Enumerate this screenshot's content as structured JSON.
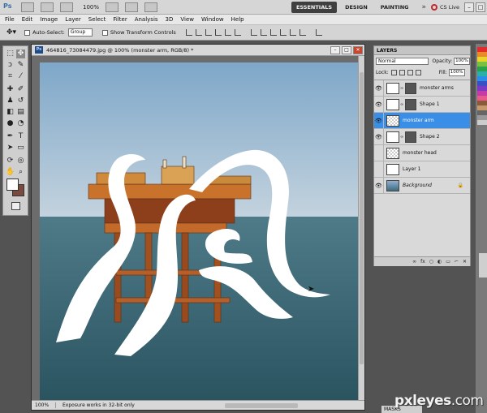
{
  "appbar": {
    "logo": "Ps",
    "zoom": "100%",
    "workspaces": [
      "ESSENTIALS",
      "DESIGN",
      "PAINTING"
    ],
    "more": "»",
    "cs_live": "CS Live"
  },
  "menu": [
    "File",
    "Edit",
    "Image",
    "Layer",
    "Select",
    "Filter",
    "Analysis",
    "3D",
    "View",
    "Window",
    "Help"
  ],
  "options": {
    "auto_select_label": "Auto-Select:",
    "auto_select_value": "Group",
    "show_transform_label": "Show Transform Controls"
  },
  "document": {
    "title": "464816_73084479.jpg @ 100% (monster arm, RGB/8) *",
    "zoom": "100%",
    "status_message": "Exposure works in 32-bit only"
  },
  "tools": {
    "foreground_color": "#ffffff",
    "background_color": "#7a4a3e"
  },
  "layers_panel": {
    "tab_label": "LAYERS",
    "blend_mode": "Normal",
    "opacity_label": "Opacity:",
    "opacity": "100%",
    "lock_label": "Lock:",
    "fill_label": "Fill:",
    "fill": "100%",
    "layers": [
      {
        "name": "monster arms",
        "visible": true,
        "thumb": "white",
        "has_mask": true,
        "selected": false,
        "italic": false
      },
      {
        "name": "Shape 1",
        "visible": true,
        "thumb": "white",
        "has_mask": true,
        "selected": false,
        "italic": false
      },
      {
        "name": "monster arm",
        "visible": true,
        "thumb": "checker",
        "has_mask": false,
        "selected": true,
        "italic": false
      },
      {
        "name": "Shape 2",
        "visible": true,
        "thumb": "white",
        "has_mask": true,
        "selected": false,
        "italic": false
      },
      {
        "name": "monster head",
        "visible": false,
        "thumb": "checker",
        "has_mask": false,
        "selected": false,
        "italic": false
      },
      {
        "name": "Layer 1",
        "visible": false,
        "thumb": "white",
        "has_mask": false,
        "selected": false,
        "italic": false
      },
      {
        "name": "Background",
        "visible": true,
        "thumb": "photo",
        "has_mask": false,
        "selected": false,
        "italic": true
      }
    ],
    "bottom_icons": [
      "fx",
      "○",
      "◐",
      "▭",
      "⌐",
      "✕"
    ]
  },
  "masks_tab": "MASKS",
  "watermark": {
    "brand": "pxleyes",
    "suffix": ".com"
  },
  "colors": {
    "selection_blue": "#3b8ee5",
    "sky_top": "#7ea7c9",
    "sea": "#35616e"
  }
}
